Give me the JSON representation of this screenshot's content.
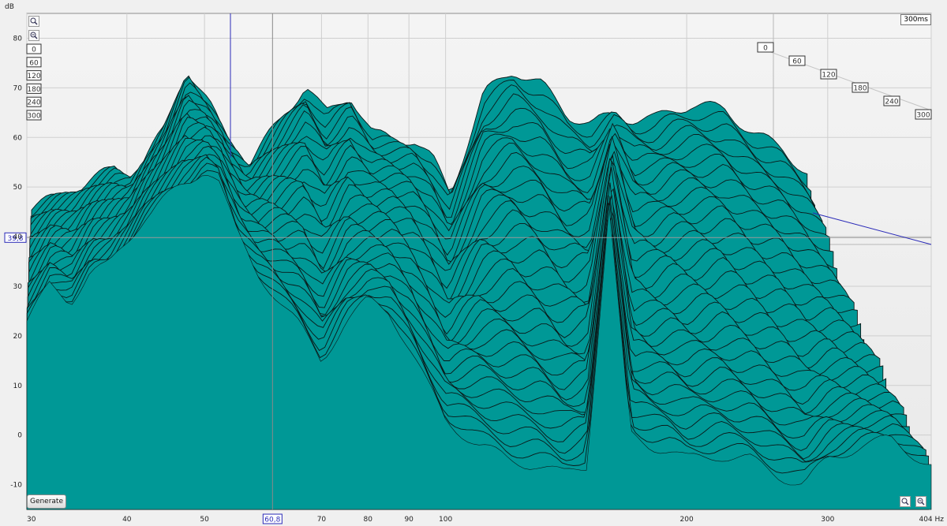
{
  "chart_data": {
    "type": "area",
    "title": "",
    "ylabel": "dB",
    "xlabel": "Hz",
    "x_scale": "log",
    "xlim": [
      30,
      404
    ],
    "ylim": [
      -15,
      85
    ],
    "y_ticks": [
      "80",
      "70",
      "60",
      "50",
      "40",
      "30",
      "20",
      "10",
      "0",
      "-10"
    ],
    "x_ticks": [
      "30",
      "40",
      "50",
      "70",
      "80",
      "90",
      "100",
      "200",
      "300",
      "404 Hz"
    ],
    "time_axis_ticks": [
      "0",
      "60",
      "120",
      "180",
      "240",
      "300"
    ],
    "time_range_label": "300ms",
    "cursor": {
      "frequency_label": "60,8",
      "level_label": "39,8"
    },
    "waterfall_slices": 40,
    "front_slice": {
      "x": [
        30,
        32,
        34,
        36,
        38,
        40,
        42,
        44,
        46,
        48,
        50,
        52,
        55,
        58,
        60.8,
        65,
        70,
        75,
        80,
        85,
        90,
        95,
        100,
        110,
        120,
        130,
        140,
        150,
        160,
        170,
        180,
        190,
        200,
        220,
        240,
        260,
        280,
        300,
        330,
        360,
        404
      ],
      "values": [
        23,
        30,
        27,
        33,
        34,
        39,
        44,
        47,
        49,
        51,
        54,
        52,
        40,
        33,
        29,
        23,
        15,
        23,
        27,
        25,
        18,
        10,
        3,
        -2,
        -5,
        -6,
        -8,
        -6,
        46,
        0,
        -2,
        -3,
        -5,
        -4,
        -5,
        -8,
        -10,
        -5,
        -2,
        -1,
        -6
      ]
    },
    "back_slice": {
      "x": [
        30,
        34,
        38,
        40,
        44,
        47,
        50,
        53,
        56,
        60.8,
        66,
        70,
        75,
        80,
        85,
        90,
        95,
        100,
        110,
        120,
        130,
        140,
        150,
        160,
        170,
        180,
        190,
        200,
        220,
        240,
        260,
        280,
        300,
        330,
        360,
        404
      ],
      "values": [
        45,
        49,
        53,
        51,
        61,
        73,
        66,
        58,
        54,
        62,
        70,
        64,
        68,
        60,
        59,
        59,
        55,
        48,
        68,
        73,
        70,
        64,
        62,
        64,
        63,
        63,
        65,
        66,
        65,
        60,
        57,
        52,
        45,
        35,
        25,
        10
      ]
    },
    "colors": {
      "fill": "#009896",
      "line": "#0b1818",
      "cursor": "#2a2ab8"
    },
    "grid": true
  },
  "controls": {
    "generate_label": "Generate"
  }
}
